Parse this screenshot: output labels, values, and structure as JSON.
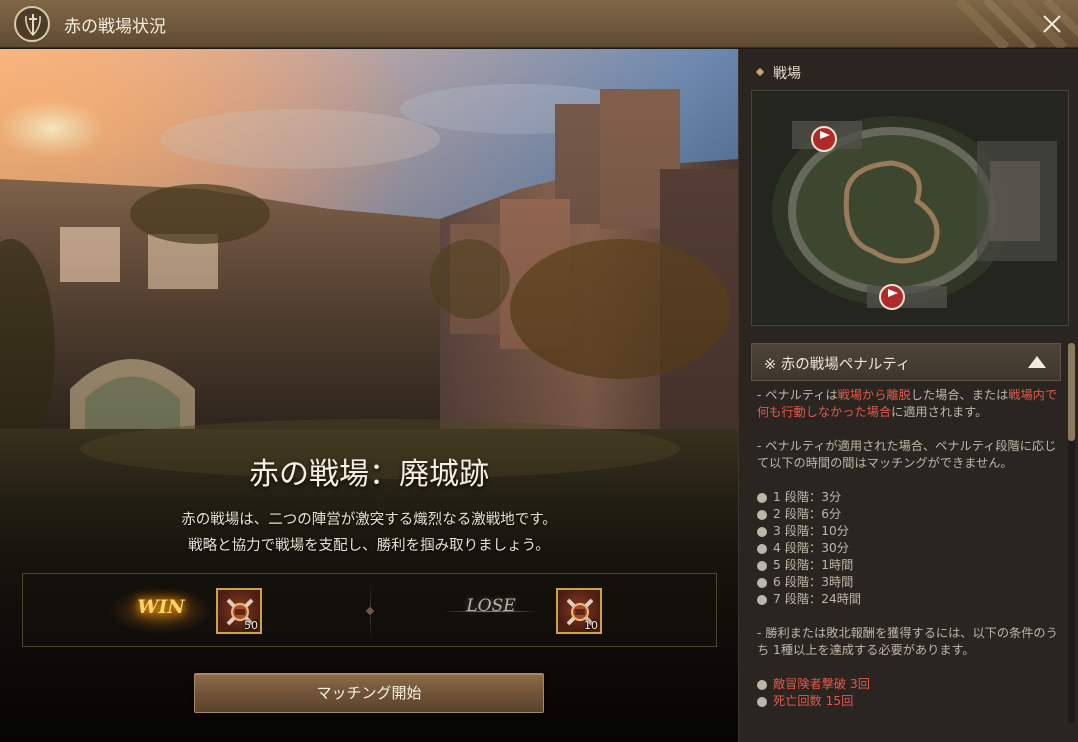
{
  "window": {
    "title": "赤の戦場状況",
    "icons": {
      "emblem": "shield-sword-emblem-icon",
      "close": "close-icon"
    }
  },
  "battlefield": {
    "title": "赤の戦場：廃城跡",
    "description_lines": [
      "赤の戦場は、二つの陣営が激突する熾烈なる激戦地です。",
      "戦略と協力で戦場を支配し、勝利を掴み取りましょう。"
    ]
  },
  "rewards": {
    "win": {
      "label": "WIN",
      "item_icon": "battle-crate-icon",
      "count": "50"
    },
    "lose": {
      "label": "LOSE",
      "item_icon": "battle-crate-icon",
      "count": "10"
    }
  },
  "match_button": {
    "label": "マッチング開始"
  },
  "side": {
    "section_title": "戦場",
    "penalty": {
      "header": "※ 赤の戦場ペナルティ",
      "p1": {
        "a": "- ペナルティは",
        "b": "戦場から離脱",
        "c": "した場合、または",
        "d": "戦場内で何も行動しなかった場合",
        "e": "に適用されます。"
      },
      "p2": "- ペナルティが適用された場合、ペナルティ段階に応じて以下の時間の間はマッチングができません。",
      "stages": [
        "1 段階：3分",
        "2 段階：6分",
        "3 段階：10分",
        "4 段階：30分",
        "5 段階：1時間",
        "6 段階：3時間",
        "7 段階：24時間"
      ],
      "p3": "- 勝利または敗北報酬を獲得するには、以下の条件のうち 1種以上を達成する必要があります。",
      "conditions": [
        "敵冒険者撃破 3回",
        "死亡回数 15回"
      ]
    }
  },
  "colors": {
    "accent_gold": "#c9a24a",
    "warning_red": "#e05a4b",
    "titlebar": "#7e6646"
  }
}
